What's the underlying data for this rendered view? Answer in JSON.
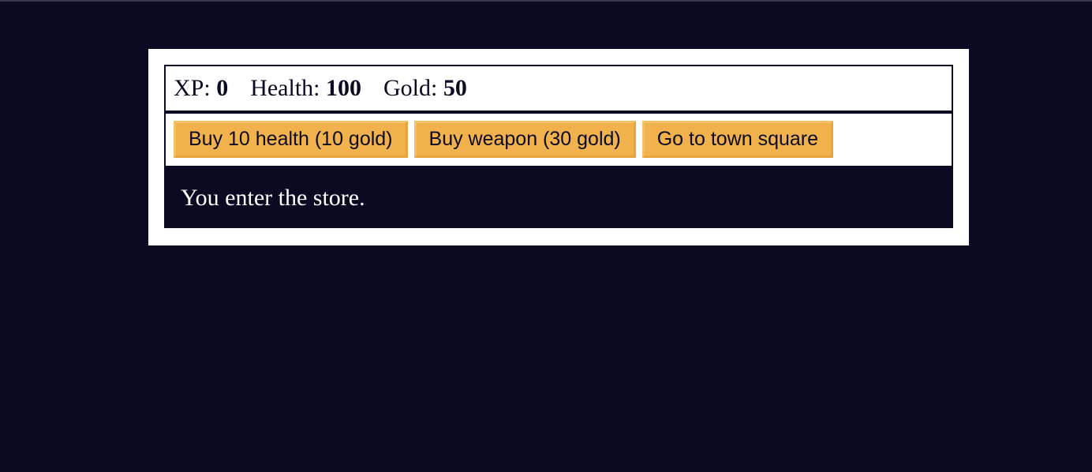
{
  "stats": {
    "xp_label": "XP:",
    "xp_value": "0",
    "health_label": "Health:",
    "health_value": "100",
    "gold_label": "Gold:",
    "gold_value": "50"
  },
  "controls": {
    "button1_label": "Buy 10 health (10 gold)",
    "button2_label": "Buy weapon (30 gold)",
    "button3_label": "Go to town square"
  },
  "message": {
    "text": "You enter the store."
  },
  "colors": {
    "background": "#0a0a23",
    "panel": "#ffffff",
    "button": "#f1b24d"
  }
}
